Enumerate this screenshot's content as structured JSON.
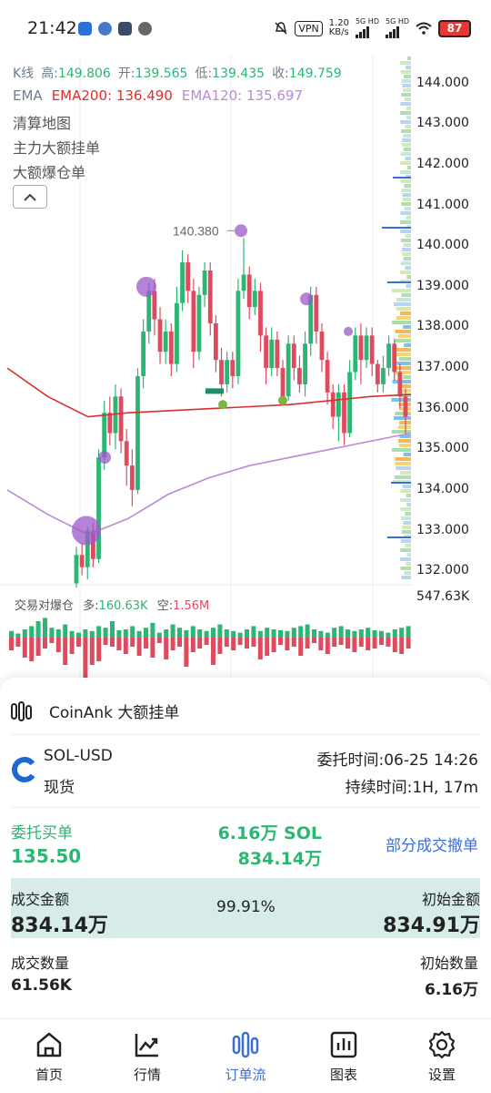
{
  "status_bar": {
    "time": "21:42",
    "vpn": "VPN",
    "net_speed_value": "1.20",
    "net_speed_unit": "KB/s",
    "sig1": "5G HD",
    "sig2": "5G HD",
    "battery": "87"
  },
  "chart": {
    "ohlc": {
      "high_label": "高:",
      "high": "149.806",
      "open_label": "开:",
      "open": "139.565",
      "low_label": "低:",
      "low": "139.435",
      "close_label": "收:",
      "close": "149.759"
    },
    "k_label": "K线",
    "ema_label": "EMA",
    "ema200": "EMA200: 136.490",
    "ema120": "EMA120: 135.697",
    "layers": [
      "清算地图",
      "主力大额挂单",
      "大额爆仓单"
    ],
    "peak_label": "140.380",
    "price_ticks": [
      "144.000",
      "143.000",
      "142.000",
      "141.000",
      "140.000",
      "139.000",
      "138.000",
      "137.000",
      "136.000",
      "135.000",
      "134.000",
      "133.000",
      "132.000"
    ],
    "liq_title": "交易对爆仓",
    "liq_long_label": "多:",
    "liq_long": "160.63K",
    "liq_short_label": "空:",
    "liq_short": "1.56M",
    "liq_axis_max": "547.63K",
    "colors": {
      "up": "#2bb673",
      "down": "#e04a5f",
      "ema200": "#d9302f",
      "ema120": "#b98ad8",
      "bubble": "#9b59c9"
    }
  },
  "chart_data": {
    "type": "candlestick",
    "ylim": [
      131.6,
      144.6
    ],
    "price_ticks": [
      144,
      143,
      142,
      141,
      140,
      139,
      138,
      137,
      136,
      135,
      134,
      133,
      132
    ],
    "candles": [
      [
        131.7,
        132.4,
        131.6,
        132.6
      ],
      [
        132.4,
        132.1,
        131.9,
        132.7
      ],
      [
        132.1,
        133.0,
        131.8,
        133.1
      ],
      [
        133.0,
        132.3,
        132.1,
        133.2
      ],
      [
        132.3,
        134.8,
        132.2,
        135.0
      ],
      [
        134.8,
        135.9,
        134.5,
        136.2
      ],
      [
        135.9,
        135.4,
        135.1,
        136.3
      ],
      [
        135.4,
        136.3,
        135.0,
        136.6
      ],
      [
        136.3,
        135.2,
        134.9,
        136.5
      ],
      [
        135.2,
        134.6,
        134.1,
        135.5
      ],
      [
        134.6,
        134.0,
        133.6,
        135.0
      ],
      [
        134.0,
        136.8,
        133.9,
        137.0
      ],
      [
        136.8,
        137.9,
        136.5,
        138.2
      ],
      [
        137.9,
        138.9,
        137.6,
        139.1
      ],
      [
        138.9,
        138.2,
        137.8,
        139.2
      ],
      [
        138.2,
        137.4,
        137.1,
        138.5
      ],
      [
        137.4,
        137.9,
        137.1,
        138.2
      ],
      [
        137.9,
        137.1,
        136.8,
        138.1
      ],
      [
        137.1,
        138.6,
        136.9,
        139.0
      ],
      [
        138.6,
        139.6,
        138.4,
        139.9
      ],
      [
        139.6,
        138.9,
        138.6,
        139.8
      ],
      [
        138.9,
        137.4,
        137.0,
        139.2
      ],
      [
        137.4,
        138.8,
        137.2,
        139.0
      ],
      [
        138.8,
        139.4,
        138.5,
        139.6
      ],
      [
        139.4,
        138.1,
        137.8,
        139.6
      ],
      [
        138.1,
        137.2,
        136.9,
        138.3
      ],
      [
        137.2,
        136.6,
        136.3,
        137.5
      ],
      [
        136.6,
        137.2,
        136.4,
        137.4
      ],
      [
        137.2,
        136.8,
        136.5,
        137.4
      ],
      [
        136.8,
        138.9,
        136.6,
        139.2
      ],
      [
        138.9,
        139.3,
        138.7,
        140.2
      ],
      [
        139.3,
        138.5,
        138.2,
        139.5
      ],
      [
        138.5,
        138.9,
        138.3,
        139.2
      ],
      [
        138.9,
        137.8,
        137.4,
        139.1
      ],
      [
        137.8,
        137.0,
        136.6,
        138.0
      ],
      [
        137.0,
        137.7,
        136.8,
        138.0
      ],
      [
        137.7,
        137.0,
        136.8,
        137.9
      ],
      [
        137.0,
        136.3,
        136.1,
        137.2
      ],
      [
        136.3,
        137.6,
        136.2,
        137.8
      ],
      [
        137.6,
        137.0,
        136.7,
        137.8
      ],
      [
        137.0,
        136.6,
        136.4,
        137.3
      ],
      [
        136.6,
        137.6,
        136.3,
        137.9
      ],
      [
        137.6,
        138.8,
        137.3,
        139.0
      ],
      [
        138.8,
        137.9,
        137.6,
        139.0
      ],
      [
        137.9,
        137.2,
        136.9,
        138.1
      ],
      [
        137.2,
        136.4,
        136.1,
        137.4
      ],
      [
        136.4,
        135.8,
        135.5,
        136.6
      ],
      [
        135.8,
        136.4,
        135.2,
        136.6
      ],
      [
        136.4,
        135.4,
        135.1,
        136.6
      ],
      [
        135.4,
        136.9,
        135.3,
        137.2
      ],
      [
        136.9,
        137.8,
        136.7,
        138.0
      ],
      [
        137.8,
        137.2,
        136.6,
        138.1
      ],
      [
        137.2,
        137.8,
        137.0,
        138.0
      ],
      [
        137.8,
        137.1,
        136.8,
        138.0
      ],
      [
        137.1,
        136.6,
        136.4,
        137.2
      ],
      [
        136.6,
        137.0,
        136.4,
        137.3
      ],
      [
        137.0,
        137.6,
        136.8,
        137.8
      ],
      [
        137.6,
        136.9,
        136.7,
        137.7
      ],
      [
        136.9,
        136.3,
        136.0,
        137.1
      ],
      [
        136.3,
        135.8,
        135.4,
        136.5
      ]
    ],
    "ema200": [
      [
        0,
        137.0
      ],
      [
        0.1,
        136.3
      ],
      [
        0.2,
        135.8
      ],
      [
        0.3,
        135.9
      ],
      [
        0.4,
        135.95
      ],
      [
        0.5,
        136.0
      ],
      [
        0.6,
        136.05
      ],
      [
        0.7,
        136.1
      ],
      [
        0.8,
        136.2
      ],
      [
        0.9,
        136.3
      ],
      [
        1.0,
        136.35
      ]
    ],
    "ema120": [
      [
        0,
        134.0
      ],
      [
        0.1,
        133.4
      ],
      [
        0.2,
        132.9
      ],
      [
        0.3,
        133.3
      ],
      [
        0.4,
        133.9
      ],
      [
        0.5,
        134.3
      ],
      [
        0.6,
        134.6
      ],
      [
        0.7,
        134.8
      ],
      [
        0.8,
        135.0
      ],
      [
        0.9,
        135.2
      ],
      [
        1.0,
        135.4
      ]
    ],
    "liquidations": {
      "long": [
        8,
        5,
        10,
        14,
        20,
        24,
        12,
        10,
        16,
        8,
        6,
        10,
        8,
        14,
        12,
        20,
        9,
        10,
        14,
        8,
        12,
        18,
        6,
        10,
        16,
        12,
        9,
        14,
        10,
        8,
        12,
        16,
        10,
        8,
        6,
        10,
        14,
        8,
        12,
        10,
        9,
        8,
        12,
        14,
        16,
        10,
        8,
        6,
        12,
        14,
        10,
        8,
        10,
        12,
        9,
        8,
        6,
        10,
        12,
        14
      ],
      "short": [
        14,
        10,
        22,
        26,
        20,
        12,
        6,
        16,
        30,
        18,
        10,
        44,
        30,
        26,
        8,
        10,
        14,
        18,
        10,
        20,
        12,
        22,
        6,
        24,
        14,
        10,
        32,
        16,
        12,
        8,
        30,
        18,
        10,
        14,
        8,
        12,
        10,
        24,
        20,
        16,
        8,
        14,
        10,
        20,
        12,
        6,
        14,
        18,
        10,
        8,
        12,
        16,
        10,
        14,
        12,
        8,
        10,
        16,
        18,
        12
      ]
    }
  },
  "order": {
    "title": "CoinAnk 大额挂单",
    "symbol": "SOL-USD",
    "market_type": "现货",
    "order_time": "委托时间:06-25 14:26",
    "duration": "持续时间:1H, 17m",
    "side_label": "委托买单",
    "qty": "6.16万 SOL",
    "price": "135.50",
    "amount": "834.14万",
    "status": "部分成交撤单",
    "filled_amount_label": "成交金额",
    "filled_amount": "834.14万",
    "fill_percent": "99.91%",
    "initial_amount_label": "初始金额",
    "initial_amount": "834.91万",
    "filled_qty_label": "成交数量",
    "filled_qty": "61.56K",
    "initial_qty_label": "初始数量",
    "initial_qty": "6.16万"
  },
  "nav": {
    "items": [
      {
        "label": "首页",
        "icon": "home-icon"
      },
      {
        "label": "行情",
        "icon": "market-chart-icon"
      },
      {
        "label": "订单流",
        "icon": "order-flow-icon"
      },
      {
        "label": "图表",
        "icon": "bar-chart-icon"
      },
      {
        "label": "设置",
        "icon": "gear-icon"
      }
    ],
    "active_index": 2
  }
}
